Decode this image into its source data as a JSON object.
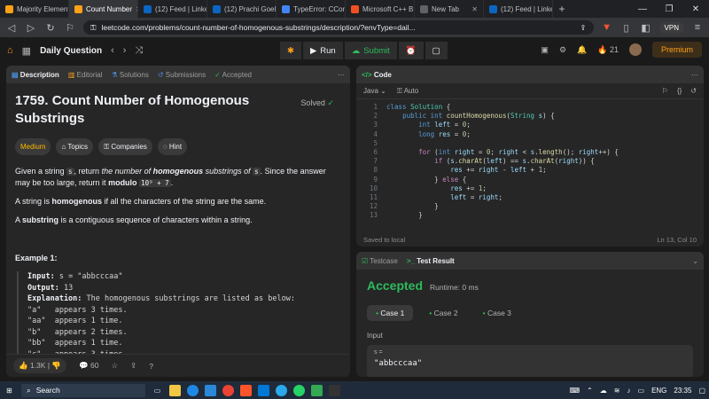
{
  "browser": {
    "tabs": [
      {
        "label": "Majority Element",
        "color": "#ffa116",
        "active": false
      },
      {
        "label": "Count Number",
        "color": "#ffa116",
        "active": true
      },
      {
        "label": "(12) Feed | Linke",
        "color": "#0a66c2",
        "active": false
      },
      {
        "label": "(12) Prachi Goel",
        "color": "#0a66c2",
        "active": false
      },
      {
        "label": "TypeError: CCom",
        "color": "#4285f4",
        "active": false
      },
      {
        "label": "Microsoft C++ B",
        "color": "#f25022",
        "active": false
      },
      {
        "label": "New Tab",
        "color": "#5f6368",
        "active": false
      },
      {
        "label": "(12) Feed | Linke",
        "color": "#0a66c2",
        "active": false
      }
    ],
    "url": "leetcode.com/problems/count-number-of-homogenous-substrings/description/?envType=dail...",
    "vpn": "VPN"
  },
  "nav": {
    "title": "Daily Question",
    "run": "Run",
    "submit": "Submit",
    "streak": "21",
    "premium": "Premium"
  },
  "left": {
    "tabs": [
      "Description",
      "Editorial",
      "Solutions",
      "Submissions",
      "Accepted"
    ],
    "title": "1759. Count Number of Homogenous Substrings",
    "solved": "Solved",
    "chips": [
      "Medium",
      "Topics",
      "Companies",
      "Hint"
    ],
    "p1_a": "Given a string ",
    "p1_s": "s",
    "p1_b": ", return ",
    "p1_c": "the number of ",
    "p1_d": "homogenous",
    "p1_e": " substrings of ",
    "p1_f": "s",
    "p1_g": ". Since the answer may be too large, return it ",
    "p1_h": "modulo",
    "p1_mod": "10⁹ + 7",
    "p1_i": ".",
    "p2_a": "A string is ",
    "p2_b": "homogenous",
    "p2_c": " if all the characters of the string are the same.",
    "p3_a": "A ",
    "p3_b": "substring",
    "p3_c": " is a contiguous sequence of characters within a string.",
    "example_title": "Example 1:",
    "input_label": "Input:",
    "input_val": " s = \"abbcccaa\"",
    "output_label": "Output:",
    "output_val": " 13",
    "expl_label": "Explanation:",
    "expl_val": " The homogenous substrings are listed as below:",
    "lines": [
      "\"a\"   appears 3 times.",
      "\"aa\"  appears 1 time.",
      "\"b\"   appears 2 times.",
      "\"bb\"  appears 1 time.",
      "\"c\"   appears 3 times."
    ],
    "likes": "1.3K",
    "comments": "60"
  },
  "code": {
    "tab": "Code",
    "lang": "Java",
    "auto": "Auto",
    "lines": [
      {
        "n": "1",
        "html": "<span class='kw'>class</span> <span class='ty'>Solution</span> {"
      },
      {
        "n": "2",
        "html": "    <span class='kw'>public int</span> <span class='fn'>countHomogenous</span>(<span class='ty'>String</span> <span class='vr'>s</span>) {"
      },
      {
        "n": "3",
        "html": "        <span class='kw'>int</span> <span class='vr'>left</span> = <span class='nm'>0</span>;"
      },
      {
        "n": "4",
        "html": "        <span class='kw'>long</span> <span class='vr'>res</span> = <span class='nm'>0</span>;"
      },
      {
        "n": "5",
        "html": ""
      },
      {
        "n": "6",
        "html": "        <span class='kc'>for</span> (<span class='kw'>int</span> <span class='vr'>right</span> = <span class='nm'>0</span>; <span class='vr'>right</span> &lt; <span class='vr'>s</span>.<span class='fn'>length</span>(); <span class='vr'>right</span>++) {"
      },
      {
        "n": "7",
        "html": "            <span class='kc'>if</span> (<span class='vr'>s</span>.<span class='fn'>charAt</span>(<span class='vr'>left</span>) == <span class='vr'>s</span>.<span class='fn'>charAt</span>(<span class='vr'>right</span>)) {"
      },
      {
        "n": "8",
        "html": "                <span class='vr'>res</span> += <span class='vr'>right</span> - <span class='vr'>left</span> + <span class='nm'>1</span>;"
      },
      {
        "n": "9",
        "html": "            } <span class='kc'>else</span> {"
      },
      {
        "n": "10",
        "html": "                <span class='vr'>res</span> += <span class='nm'>1</span>;"
      },
      {
        "n": "11",
        "html": "                <span class='vr'>left</span> = <span class='vr'>right</span>;"
      },
      {
        "n": "12",
        "html": "            }"
      },
      {
        "n": "13",
        "html": "        }"
      }
    ],
    "saved": "Saved to local",
    "cursor": "Ln 13, Col 10"
  },
  "test": {
    "tabs": [
      "Testcase",
      "Test Result"
    ],
    "status": "Accepted",
    "runtime": "Runtime: 0 ms",
    "cases": [
      "Case 1",
      "Case 2",
      "Case 3"
    ],
    "input_label": "Input",
    "var": "s =",
    "value": "\"abbcccaa\""
  },
  "taskbar": {
    "search": "Search",
    "lang": "ENG",
    "time": "23:35"
  }
}
